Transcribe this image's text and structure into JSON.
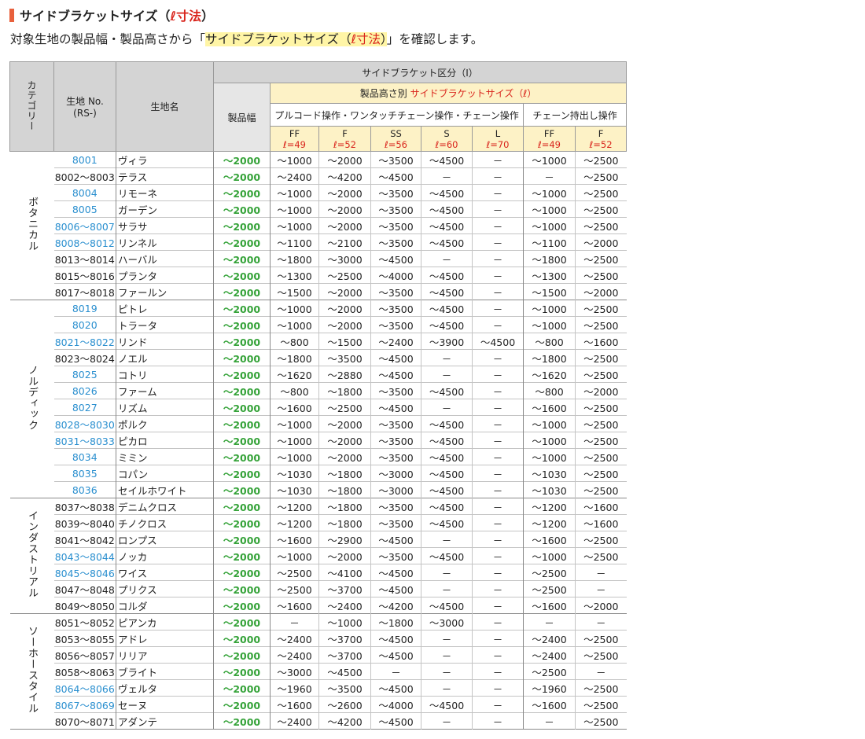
{
  "heading": {
    "title_main": "サイドブラケットサイズ",
    "title_paren_open": "（",
    "title_accent": "ℓ寸法",
    "title_paren_close": "）"
  },
  "subtitle": {
    "prefix": "対象生地の製品幅・製品高さから「",
    "hl_main": "サイドブラケットサイズ",
    "hl_paren_open": "（",
    "hl_red": "ℓ寸法",
    "hl_paren_close": "）",
    "suffix": "」を確認します。"
  },
  "table_header": {
    "category": "カテゴリー",
    "fabric_no": "生地 No.",
    "fabric_no_sub": "(RS-)",
    "fabric_name": "生地名",
    "division": "サイドブラケット区分（Ⅰ）",
    "width": "製品幅",
    "height_by_prefix": "製品高さ別 ",
    "height_by_red": "サイドブラケットサイズ（ℓ）",
    "op_pullcord": "プルコード操作・ワンタッチチェーン操作・チェーン操作",
    "op_chain": "チェーン持出し操作",
    "sizes": [
      {
        "code": "FF",
        "l": "ℓ=49"
      },
      {
        "code": "F",
        "l": "ℓ=52"
      },
      {
        "code": "SS",
        "l": "ℓ=56"
      },
      {
        "code": "S",
        "l": "ℓ=60"
      },
      {
        "code": "L",
        "l": "ℓ=70"
      },
      {
        "code": "FF",
        "l": "ℓ=49"
      },
      {
        "code": "F",
        "l": "ℓ=52"
      }
    ]
  },
  "colors": {
    "title_bar": "#e8603c",
    "accent_red": "#d9251d",
    "fabric_no_blue": "#2a8fcf",
    "width_green": "#36a33a",
    "highlight_yellow": "#fff5a6",
    "header_gray": "#d4d4d4",
    "header_cream": "#fdf2c6"
  },
  "groups": [
    {
      "category": "ボタニカル",
      "rows": [
        {
          "no": "8001",
          "blue": true,
          "name": "ヴィラ",
          "width": "～2000",
          "values": [
            "～1000",
            "～2000",
            "～3500",
            "～4500",
            "－",
            "～1000",
            "～2500"
          ]
        },
        {
          "no": "8002～8003",
          "blue": false,
          "name": "テラス",
          "width": "～2000",
          "values": [
            "～2400",
            "～4200",
            "～4500",
            "－",
            "－",
            "－",
            "～2500"
          ]
        },
        {
          "no": "8004",
          "blue": true,
          "name": "リモーネ",
          "width": "～2000",
          "values": [
            "～1000",
            "～2000",
            "～3500",
            "～4500",
            "－",
            "～1000",
            "～2500"
          ]
        },
        {
          "no": "8005",
          "blue": true,
          "name": "ガーデン",
          "width": "～2000",
          "values": [
            "～1000",
            "～2000",
            "～3500",
            "～4500",
            "－",
            "～1000",
            "～2500"
          ]
        },
        {
          "no": "8006～8007",
          "blue": true,
          "name": "サラサ",
          "width": "～2000",
          "values": [
            "～1000",
            "～2000",
            "～3500",
            "～4500",
            "－",
            "～1000",
            "～2500"
          ]
        },
        {
          "no": "8008～8012",
          "blue": true,
          "name": "リンネル",
          "width": "～2000",
          "values": [
            "～1100",
            "～2100",
            "～3500",
            "～4500",
            "－",
            "～1100",
            "～2000"
          ]
        },
        {
          "no": "8013～8014",
          "blue": false,
          "name": "ハーバル",
          "width": "～2000",
          "values": [
            "～1800",
            "～3000",
            "～4500",
            "－",
            "－",
            "～1800",
            "～2500"
          ]
        },
        {
          "no": "8015～8016",
          "blue": false,
          "name": "プランタ",
          "width": "～2000",
          "values": [
            "～1300",
            "～2500",
            "～4000",
            "～4500",
            "－",
            "～1300",
            "～2500"
          ]
        },
        {
          "no": "8017～8018",
          "blue": false,
          "name": "ファールン",
          "width": "～2000",
          "values": [
            "～1500",
            "～2000",
            "～3500",
            "～4500",
            "－",
            "～1500",
            "～2000"
          ]
        }
      ]
    },
    {
      "category": "ノルディック",
      "rows": [
        {
          "no": "8019",
          "blue": true,
          "name": "ピトレ",
          "width": "～2000",
          "values": [
            "～1000",
            "～2000",
            "～3500",
            "～4500",
            "－",
            "～1000",
            "～2500"
          ]
        },
        {
          "no": "8020",
          "blue": true,
          "name": "トラータ",
          "width": "～2000",
          "values": [
            "～1000",
            "～2000",
            "～3500",
            "～4500",
            "－",
            "～1000",
            "～2500"
          ]
        },
        {
          "no": "8021～8022",
          "blue": true,
          "name": "リンド",
          "width": "～2000",
          "values": [
            "～800",
            "～1500",
            "～2400",
            "～3900",
            "～4500",
            "～800",
            "～1600"
          ]
        },
        {
          "no": "8023～8024",
          "blue": false,
          "name": "ノエル",
          "width": "～2000",
          "values": [
            "～1800",
            "～3500",
            "～4500",
            "－",
            "－",
            "～1800",
            "～2500"
          ]
        },
        {
          "no": "8025",
          "blue": true,
          "name": "コトリ",
          "width": "～2000",
          "values": [
            "～1620",
            "～2880",
            "～4500",
            "－",
            "－",
            "～1620",
            "～2500"
          ]
        },
        {
          "no": "8026",
          "blue": true,
          "name": "ファーム",
          "width": "～2000",
          "values": [
            "～800",
            "～1800",
            "～3500",
            "～4500",
            "－",
            "～800",
            "～2000"
          ]
        },
        {
          "no": "8027",
          "blue": true,
          "name": "リズム",
          "width": "～2000",
          "values": [
            "～1600",
            "～2500",
            "～4500",
            "－",
            "－",
            "～1600",
            "～2500"
          ]
        },
        {
          "no": "8028～8030",
          "blue": true,
          "name": "ポルク",
          "width": "～2000",
          "values": [
            "～1000",
            "～2000",
            "～3500",
            "～4500",
            "－",
            "～1000",
            "～2500"
          ]
        },
        {
          "no": "8031～8033",
          "blue": true,
          "name": "ピカロ",
          "width": "～2000",
          "values": [
            "～1000",
            "～2000",
            "～3500",
            "～4500",
            "－",
            "～1000",
            "～2500"
          ]
        },
        {
          "no": "8034",
          "blue": true,
          "name": "ミミン",
          "width": "～2000",
          "values": [
            "～1000",
            "～2000",
            "～3500",
            "～4500",
            "－",
            "～1000",
            "～2500"
          ]
        },
        {
          "no": "8035",
          "blue": true,
          "name": "コパン",
          "width": "～2000",
          "values": [
            "～1030",
            "～1800",
            "～3000",
            "～4500",
            "－",
            "～1030",
            "～2500"
          ]
        },
        {
          "no": "8036",
          "blue": true,
          "name": "セイルホワイト",
          "width": "～2000",
          "values": [
            "～1030",
            "～1800",
            "～3000",
            "～4500",
            "－",
            "～1030",
            "～2500"
          ]
        }
      ]
    },
    {
      "category": "インダストリアル",
      "rows": [
        {
          "no": "8037～8038",
          "blue": false,
          "name": "デニムクロス",
          "width": "～2000",
          "values": [
            "～1200",
            "～1800",
            "～3500",
            "～4500",
            "－",
            "～1200",
            "～1600"
          ]
        },
        {
          "no": "8039～8040",
          "blue": false,
          "name": "チノクロス",
          "width": "～2000",
          "values": [
            "～1200",
            "～1800",
            "～3500",
            "～4500",
            "－",
            "～1200",
            "～1600"
          ]
        },
        {
          "no": "8041～8042",
          "blue": false,
          "name": "ロンプス",
          "width": "～2000",
          "values": [
            "～1600",
            "～2900",
            "～4500",
            "－",
            "－",
            "～1600",
            "～2500"
          ]
        },
        {
          "no": "8043～8044",
          "blue": true,
          "name": "ノッカ",
          "width": "～2000",
          "values": [
            "～1000",
            "～2000",
            "～3500",
            "～4500",
            "－",
            "～1000",
            "～2500"
          ]
        },
        {
          "no": "8045～8046",
          "blue": true,
          "name": "ワイス",
          "width": "～2000",
          "values": [
            "～2500",
            "～4100",
            "～4500",
            "－",
            "－",
            "～2500",
            "－"
          ]
        },
        {
          "no": "8047～8048",
          "blue": false,
          "name": "プリクス",
          "width": "～2000",
          "values": [
            "～2500",
            "～3700",
            "～4500",
            "－",
            "－",
            "～2500",
            "－"
          ]
        },
        {
          "no": "8049～8050",
          "blue": false,
          "name": "コルダ",
          "width": "～2000",
          "values": [
            "～1600",
            "～2400",
            "～4200",
            "～4500",
            "－",
            "～1600",
            "～2000"
          ]
        }
      ]
    },
    {
      "category": "ソーホースタイル",
      "rows": [
        {
          "no": "8051～8052",
          "blue": false,
          "name": "ピアンカ",
          "width": "～2000",
          "values": [
            "－",
            "～1000",
            "～1800",
            "～3000",
            "－",
            "－",
            "－"
          ]
        },
        {
          "no": "8053～8055",
          "blue": false,
          "name": "アドレ",
          "width": "～2000",
          "values": [
            "～2400",
            "～3700",
            "～4500",
            "－",
            "－",
            "～2400",
            "～2500"
          ]
        },
        {
          "no": "8056～8057",
          "blue": false,
          "name": "リリア",
          "width": "～2000",
          "values": [
            "～2400",
            "～3700",
            "～4500",
            "－",
            "－",
            "～2400",
            "～2500"
          ]
        },
        {
          "no": "8058～8063",
          "blue": false,
          "name": "ブライト",
          "width": "～2000",
          "values": [
            "～3000",
            "～4500",
            "－",
            "－",
            "－",
            "～2500",
            "－"
          ]
        },
        {
          "no": "8064～8066",
          "blue": true,
          "name": "ヴェルタ",
          "width": "～2000",
          "values": [
            "～1960",
            "～3500",
            "～4500",
            "－",
            "－",
            "～1960",
            "～2500"
          ]
        },
        {
          "no": "8067～8069",
          "blue": true,
          "name": "セーヌ",
          "width": "～2000",
          "values": [
            "～1600",
            "～2600",
            "～4000",
            "～4500",
            "－",
            "～1600",
            "～2500"
          ]
        },
        {
          "no": "8070～8071",
          "blue": false,
          "name": "アダンテ",
          "width": "～2000",
          "values": [
            "～2400",
            "～4200",
            "～4500",
            "－",
            "－",
            "－",
            "～2500"
          ]
        }
      ]
    }
  ]
}
